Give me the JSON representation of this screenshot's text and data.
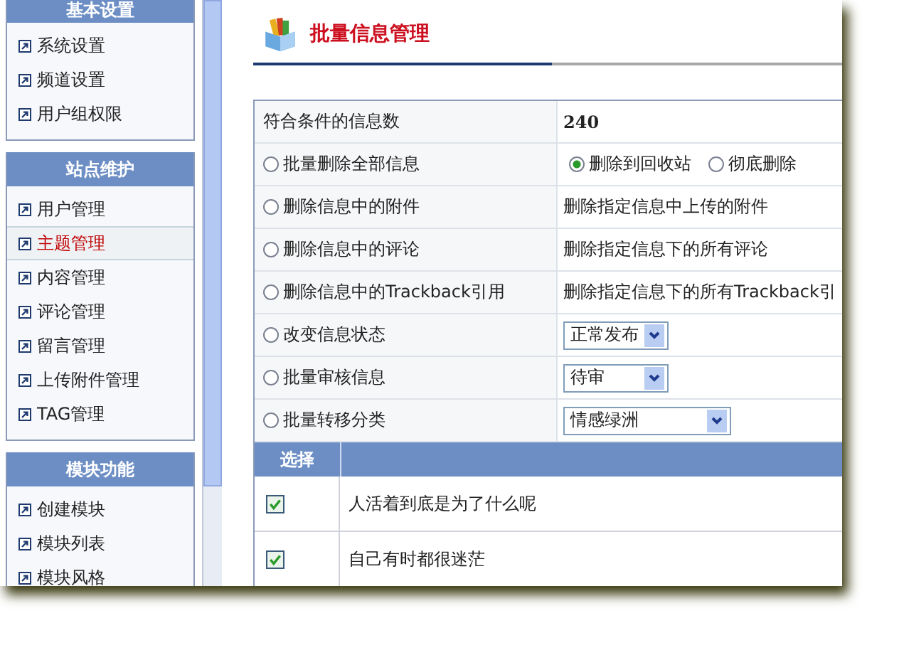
{
  "sidebar": {
    "sections": [
      {
        "title": "基本设置",
        "items": [
          {
            "label": "系统设置",
            "selected": false
          },
          {
            "label": "频道设置",
            "selected": false
          },
          {
            "label": "用户组权限",
            "selected": false
          }
        ]
      },
      {
        "title": "站点维护",
        "items": [
          {
            "label": "用户管理",
            "selected": false
          },
          {
            "label": "主题管理",
            "selected": true
          },
          {
            "label": "内容管理",
            "selected": false
          },
          {
            "label": "评论管理",
            "selected": false
          },
          {
            "label": "留言管理",
            "selected": false
          },
          {
            "label": "上传附件管理",
            "selected": false
          },
          {
            "label": "TAG管理",
            "selected": false
          }
        ]
      },
      {
        "title": "模块功能",
        "items": [
          {
            "label": "创建模块",
            "selected": false
          },
          {
            "label": "模块列表",
            "selected": false
          },
          {
            "label": "模块风格",
            "selected": false
          }
        ]
      }
    ]
  },
  "page_title": "批量信息管理",
  "count": {
    "label": "符合条件的信息数",
    "value": "240"
  },
  "operations": [
    {
      "label": "批量删除全部信息",
      "selected": false,
      "kind": "radios",
      "options": [
        {
          "label": "删除到回收站",
          "selected": true
        },
        {
          "label": "彻底删除",
          "selected": false
        }
      ]
    },
    {
      "label": "删除信息中的附件",
      "selected": false,
      "kind": "text",
      "text": "删除指定信息中上传的附件"
    },
    {
      "label": "删除信息中的评论",
      "selected": false,
      "kind": "text",
      "text": "删除指定信息下的所有评论"
    },
    {
      "label": "删除信息中的Trackback引用",
      "selected": false,
      "kind": "text",
      "text": "删除指定信息下的所有Trackback引"
    },
    {
      "label": "改变信息状态",
      "selected": false,
      "kind": "select",
      "value": "正常发布"
    },
    {
      "label": "批量审核信息",
      "selected": false,
      "kind": "select",
      "value": "待审"
    },
    {
      "label": "批量转移分类",
      "selected": false,
      "kind": "select",
      "value": "情感绿洲"
    }
  ],
  "list": {
    "columns": [
      "选择"
    ],
    "rows": [
      {
        "title": "人活着到底是为了什么呢",
        "checked": true
      },
      {
        "title": "自己有时都很迷茫",
        "checked": true
      }
    ]
  }
}
